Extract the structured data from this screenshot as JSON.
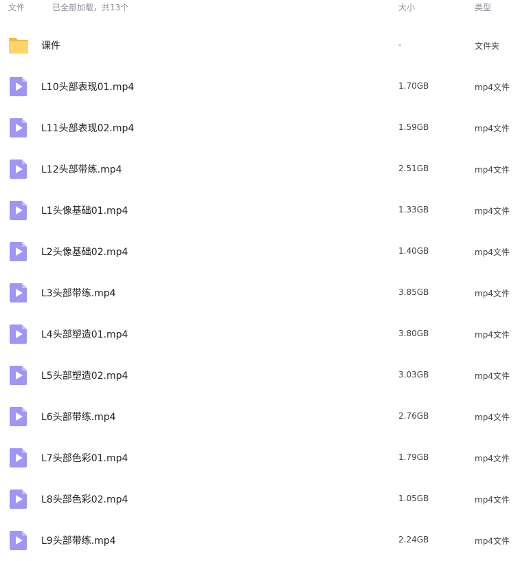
{
  "header": {
    "file_label": "文件",
    "loaded_text": "已全部加载，共13个",
    "size_label": "大小",
    "type_label": "类型"
  },
  "colors": {
    "folder": "#FFD56B",
    "video": "#9E95F5",
    "header_text": "#8A8F99"
  },
  "files": [
    {
      "name": "课件",
      "size": "-",
      "type": "文件夹",
      "icon": "folder-icon"
    },
    {
      "name": "L10头部表现01.mp4",
      "size": "1.70GB",
      "type": "mp4文件",
      "icon": "video-file-icon"
    },
    {
      "name": "L11头部表现02.mp4",
      "size": "1.59GB",
      "type": "mp4文件",
      "icon": "video-file-icon"
    },
    {
      "name": "L12头部带练.mp4",
      "size": "2.51GB",
      "type": "mp4文件",
      "icon": "video-file-icon"
    },
    {
      "name": "L1头像基础01.mp4",
      "size": "1.33GB",
      "type": "mp4文件",
      "icon": "video-file-icon"
    },
    {
      "name": "L2头像基础02.mp4",
      "size": "1.40GB",
      "type": "mp4文件",
      "icon": "video-file-icon"
    },
    {
      "name": "L3头部带练.mp4",
      "size": "3.85GB",
      "type": "mp4文件",
      "icon": "video-file-icon"
    },
    {
      "name": "L4头部塑造01.mp4",
      "size": "3.80GB",
      "type": "mp4文件",
      "icon": "video-file-icon"
    },
    {
      "name": "L5头部塑造02.mp4",
      "size": "3.03GB",
      "type": "mp4文件",
      "icon": "video-file-icon"
    },
    {
      "name": "L6头部带练.mp4",
      "size": "2.76GB",
      "type": "mp4文件",
      "icon": "video-file-icon"
    },
    {
      "name": "L7头部色彩01.mp4",
      "size": "1.79GB",
      "type": "mp4文件",
      "icon": "video-file-icon"
    },
    {
      "name": "L8头部色彩02.mp4",
      "size": "1.05GB",
      "type": "mp4文件",
      "icon": "video-file-icon"
    },
    {
      "name": "L9头部带练.mp4",
      "size": "2.24GB",
      "type": "mp4文件",
      "icon": "video-file-icon"
    }
  ]
}
